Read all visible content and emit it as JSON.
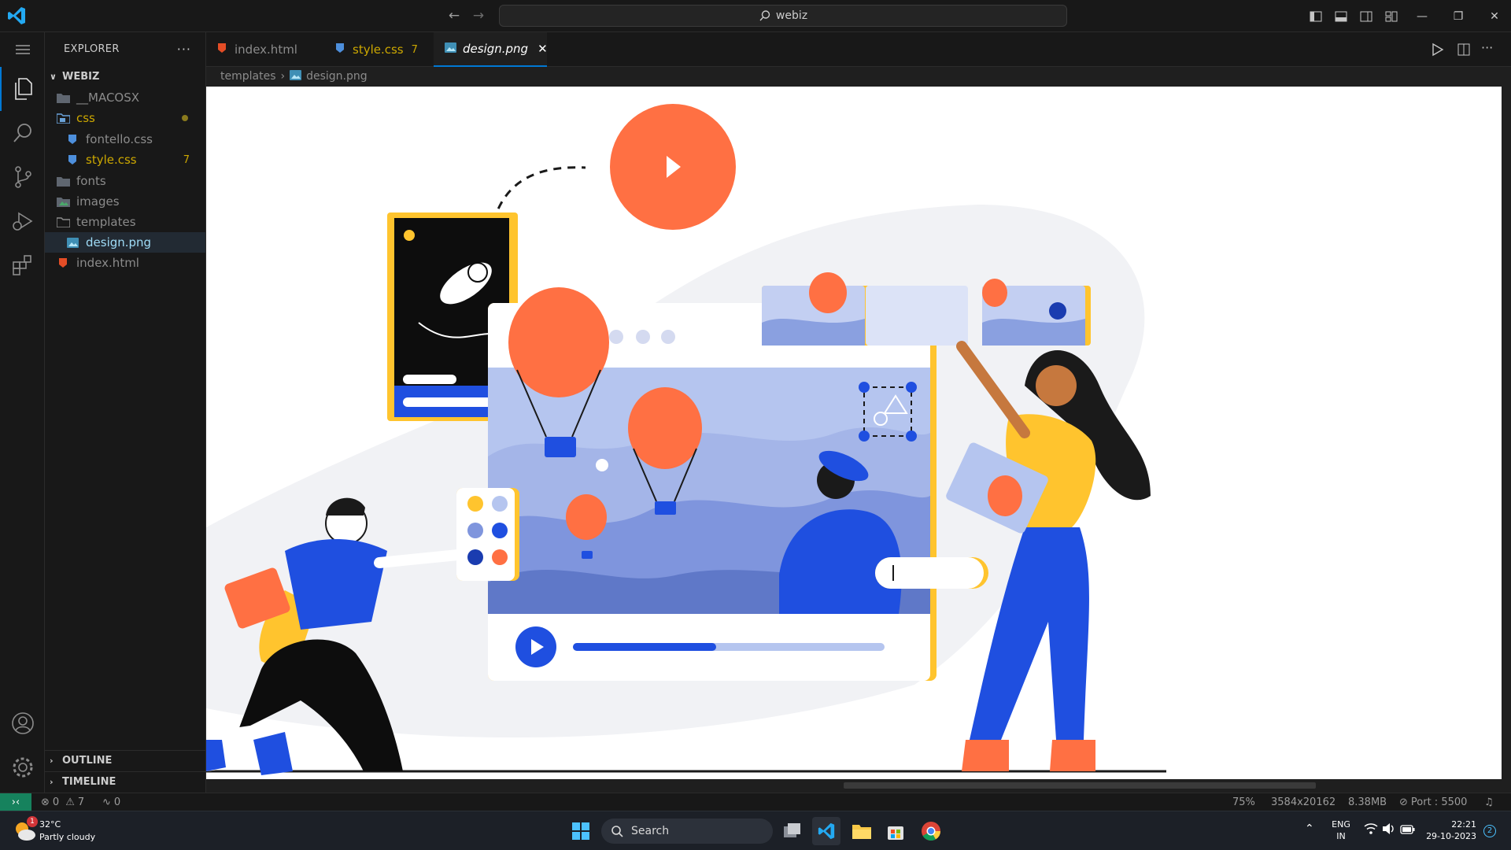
{
  "titlebar": {
    "search_text": "webiz"
  },
  "explorer": {
    "title": "EXPLORER",
    "workspace": "WEBIZ",
    "items": [
      {
        "label": "__MACOSX",
        "kind": "folder",
        "color": "#8b8b8b"
      },
      {
        "label": "css",
        "kind": "folder-open",
        "color": "#cca700",
        "badge": "dot"
      },
      {
        "label": "fontello.css",
        "kind": "css",
        "color": "#8b8b8b"
      },
      {
        "label": "style.css",
        "kind": "css",
        "color": "#cca700",
        "badge": "7"
      },
      {
        "label": "fonts",
        "kind": "folder",
        "color": "#8b8b8b"
      },
      {
        "label": "images",
        "kind": "folder-img",
        "color": "#8b8b8b"
      },
      {
        "label": "templates",
        "kind": "folder-open",
        "color": "#8b8b8b"
      },
      {
        "label": "design.png",
        "kind": "image",
        "color": "#9fdcf7"
      },
      {
        "label": "index.html",
        "kind": "html",
        "color": "#8b8b8b"
      }
    ],
    "outline": "OUTLINE",
    "timeline": "TIMELINE"
  },
  "tabs": [
    {
      "label": "index.html",
      "color": "#8b8b8b",
      "badge": ""
    },
    {
      "label": "style.css",
      "color": "#cca700",
      "badge": "7"
    },
    {
      "label": "design.png",
      "color": "#ffffff",
      "badge": ""
    }
  ],
  "breadcrumbs": [
    "templates",
    "design.png"
  ],
  "statusbar": {
    "errors": "0",
    "warnings": "7",
    "ports": "0",
    "zoom": "75%",
    "dimensions": "3584x20162",
    "filesize": "8.38MB",
    "port": "Port : 5500"
  },
  "taskbar": {
    "weather_temp": "32°C",
    "weather_desc": "Partly cloudy",
    "weather_badge": "1",
    "search_label": "Search",
    "lang": "ENG",
    "region": "IN",
    "time": "22:21",
    "date": "29-10-2023",
    "notif_count": "2"
  },
  "colors": {
    "accent": "#0078d4",
    "warning": "#cca700",
    "orange": "#ff7043",
    "blue": "#1f4fe0",
    "yellow": "#ffc42e"
  }
}
